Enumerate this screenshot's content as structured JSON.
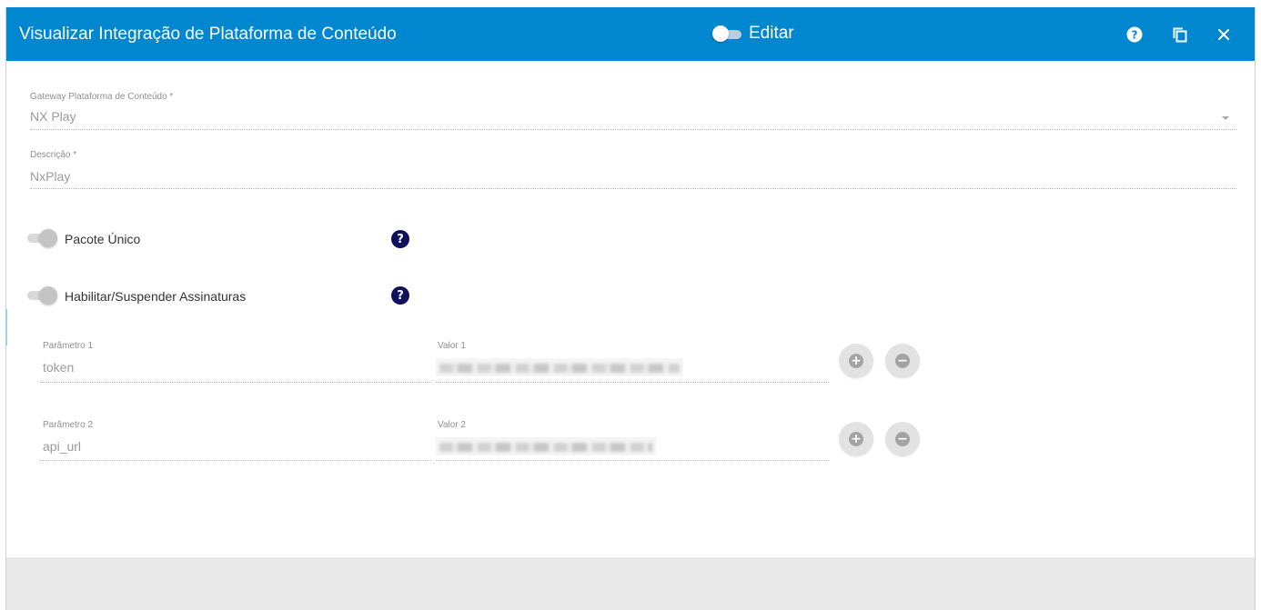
{
  "header": {
    "title": "Visualizar Integração de Plataforma de Conteúdo",
    "edit_label": "Editar",
    "edit_toggle_on": false,
    "background_color": "#0187d0"
  },
  "form": {
    "gateway": {
      "label": "Gateway Plataforma de Conteúdo *",
      "value": "NX Play"
    },
    "descricao": {
      "label": "Descrição *",
      "value": "NxPlay"
    },
    "pacote_unico": {
      "label": "Pacote Único",
      "checked": false
    },
    "habilitar_suspender": {
      "label": "Habilitar/Suspender Assinaturas",
      "checked": false
    },
    "params": [
      {
        "param_label": "Parâmetro 1",
        "param_value": "token",
        "valor_label": "Valor 1"
      },
      {
        "param_label": "Parâmetro 2",
        "param_value": "api_url",
        "valor_label": "Valor 2"
      }
    ]
  },
  "icons": {
    "help": "question-circle-icon",
    "copy": "copy-icon",
    "close": "close-icon",
    "add": "plus-circle-icon",
    "remove": "minus-circle-icon"
  },
  "help_icon_color": "#10115c"
}
